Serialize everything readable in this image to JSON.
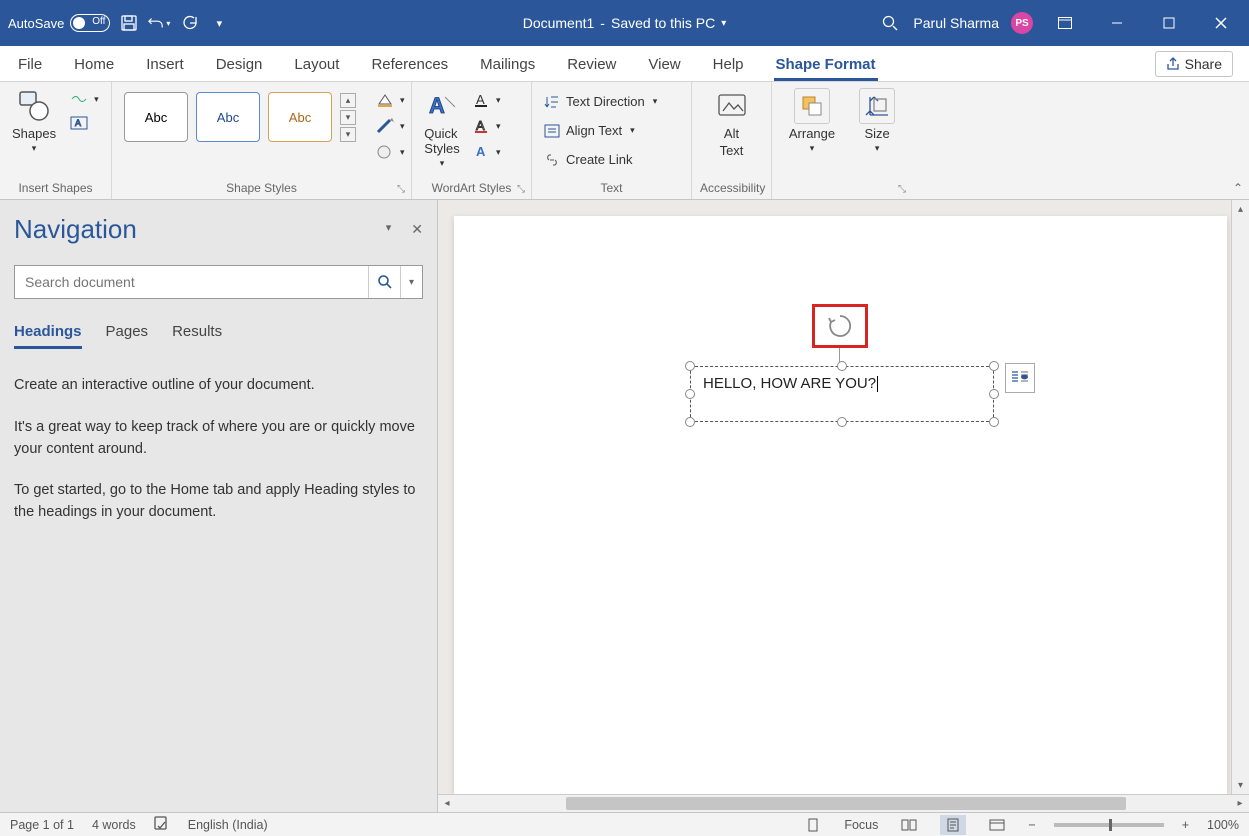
{
  "titlebar": {
    "autosave_label": "AutoSave",
    "autosave_state": "Off",
    "doc_name": "Document1",
    "save_status": "Saved to this PC",
    "user_name": "Parul Sharma",
    "user_initials": "PS"
  },
  "tabs": {
    "file": "File",
    "home": "Home",
    "insert": "Insert",
    "design": "Design",
    "layout": "Layout",
    "references": "References",
    "mailings": "Mailings",
    "review": "Review",
    "view": "View",
    "help": "Help",
    "shape_format": "Shape Format",
    "share": "Share"
  },
  "ribbon": {
    "insert_shapes": {
      "shapes": "Shapes",
      "label": "Insert Shapes"
    },
    "shape_styles": {
      "sample": "Abc",
      "label": "Shape Styles"
    },
    "wordart": {
      "quick_styles": "Quick\nStyles",
      "label": "WordArt Styles"
    },
    "text": {
      "direction": "Text Direction",
      "align": "Align Text",
      "link": "Create Link",
      "label": "Text"
    },
    "accessibility": {
      "alt_text_line1": "Alt",
      "alt_text_line2": "Text",
      "label": "Accessibility"
    },
    "arrange": {
      "arrange": "Arrange",
      "size": "Size"
    }
  },
  "navigation": {
    "title": "Navigation",
    "search_placeholder": "Search document",
    "tabs": {
      "headings": "Headings",
      "pages": "Pages",
      "results": "Results"
    },
    "p1": "Create an interactive outline of your document.",
    "p2": "It's a great way to keep track of where you are or quickly move your content around.",
    "p3": "To get started, go to the Home tab and apply Heading styles to the headings in your document."
  },
  "document": {
    "textbox_content": "HELLO, HOW ARE YOU?"
  },
  "statusbar": {
    "page": "Page 1 of 1",
    "words": "4 words",
    "language": "English (India)",
    "focus": "Focus",
    "zoom": "100%"
  }
}
